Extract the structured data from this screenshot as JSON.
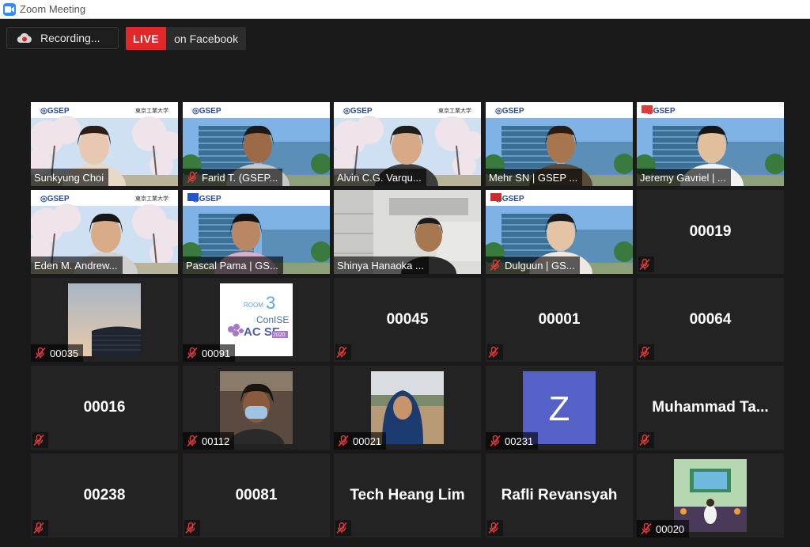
{
  "window": {
    "title": "Zoom Meeting"
  },
  "recording": {
    "label": "Recording..."
  },
  "live": {
    "badge": "LIVE",
    "platform": "on Facebook"
  },
  "colors": {
    "live_red": "#e02828",
    "active_speaker": "#c9e265",
    "zoom_blue": "#2d8cff",
    "avatar_z": "#5561c7"
  },
  "participants": [
    {
      "name": "Sunkyung Choi",
      "kind": "video",
      "muted": false
    },
    {
      "name": "Farid T. (GSEP...",
      "kind": "video",
      "muted": true
    },
    {
      "name": "Alvin C.G. Varqu...",
      "kind": "video",
      "muted": false
    },
    {
      "name": "Mehr SN | GSEP ...",
      "kind": "video",
      "muted": false
    },
    {
      "name": "Jeremy Gavriel | ...",
      "kind": "video",
      "muted": false
    },
    {
      "name": "Eden M. Andrew...",
      "kind": "video",
      "muted": false
    },
    {
      "name": "Pascal Pama | GS...",
      "kind": "video",
      "muted": false,
      "active": true
    },
    {
      "name": "Shinya Hanaoka ...",
      "kind": "video",
      "muted": false
    },
    {
      "name": "Dulguun | GS...",
      "kind": "video",
      "muted": true
    },
    {
      "name": "00019",
      "kind": "name",
      "muted": true
    },
    {
      "name": "00035",
      "kind": "photo",
      "muted": true,
      "icon": "sky-building-photo"
    },
    {
      "name": "00091",
      "kind": "photo",
      "muted": true,
      "icon": "room3-conise-logo"
    },
    {
      "name": "00045",
      "kind": "name",
      "muted": true
    },
    {
      "name": "00001",
      "kind": "name",
      "muted": true
    },
    {
      "name": "00064",
      "kind": "name",
      "muted": true
    },
    {
      "name": "00016",
      "kind": "name",
      "muted": true
    },
    {
      "name": "00112",
      "kind": "photo",
      "muted": true,
      "icon": "masked-person-photo"
    },
    {
      "name": "00021",
      "kind": "photo",
      "muted": true,
      "icon": "hijab-person-photo"
    },
    {
      "name": "00231",
      "kind": "photo",
      "muted": true,
      "icon": "letter-avatar",
      "letter": "Z"
    },
    {
      "name": "Muhammad  Ta...",
      "kind": "name",
      "muted": true
    },
    {
      "name": "00238",
      "kind": "name",
      "muted": true
    },
    {
      "name": "00081",
      "kind": "name",
      "muted": true
    },
    {
      "name": "Tech Heang Lim",
      "kind": "name",
      "muted": true
    },
    {
      "name": "Rafli Revansyah",
      "kind": "name",
      "muted": true
    },
    {
      "name": "00020",
      "kind": "photo",
      "muted": true,
      "icon": "stage-event-photo"
    }
  ],
  "room_logo": {
    "room": "ROOM",
    "number": "3",
    "conise": "ConISE",
    "acise": "AC SE",
    "year": "2020"
  },
  "gsep_logo": "GSEP"
}
